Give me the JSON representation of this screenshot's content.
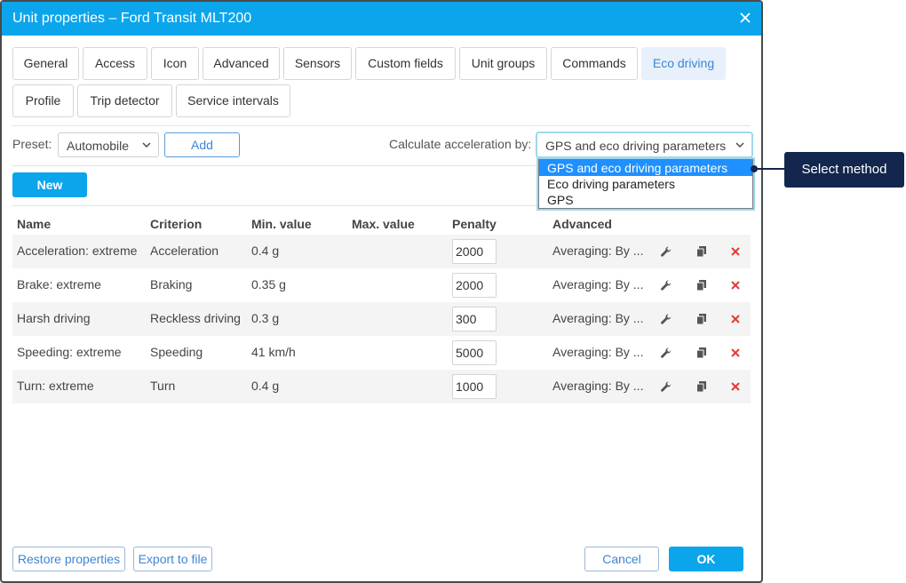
{
  "dialog": {
    "title": "Unit properties – Ford Transit MLT200"
  },
  "tabs": [
    {
      "label": "General"
    },
    {
      "label": "Access"
    },
    {
      "label": "Icon"
    },
    {
      "label": "Advanced"
    },
    {
      "label": "Sensors"
    },
    {
      "label": "Custom fields"
    },
    {
      "label": "Unit groups"
    },
    {
      "label": "Commands"
    },
    {
      "label": "Eco driving",
      "active": true
    },
    {
      "label": "Profile"
    },
    {
      "label": "Trip detector"
    },
    {
      "label": "Service intervals"
    }
  ],
  "toolbar": {
    "preset_label": "Preset:",
    "preset_value": "Automobile",
    "add_label": "Add",
    "accel_label": "Calculate acceleration by:",
    "accel_value": "GPS and eco driving parameters",
    "new_label": "New"
  },
  "dropdown": {
    "options": [
      "GPS and eco driving parameters",
      "Eco driving parameters",
      "GPS"
    ],
    "selected_index": 0
  },
  "callout": {
    "text": "Select method"
  },
  "table": {
    "headers": {
      "name": "Name",
      "criterion": "Criterion",
      "min": "Min. value",
      "max": "Max. value",
      "penalty": "Penalty",
      "advanced": "Advanced"
    },
    "rows": [
      {
        "name": "Acceleration: extreme",
        "criterion": "Acceleration",
        "min": "0.4 g",
        "max": "",
        "penalty": "2000",
        "advanced": "Averaging: By ..."
      },
      {
        "name": "Brake: extreme",
        "criterion": "Braking",
        "min": "0.35 g",
        "max": "",
        "penalty": "2000",
        "advanced": "Averaging: By ..."
      },
      {
        "name": "Harsh driving",
        "criterion": "Reckless driving",
        "min": "0.3 g",
        "max": "",
        "penalty": "300",
        "advanced": "Averaging: By ..."
      },
      {
        "name": "Speeding: extreme",
        "criterion": "Speeding",
        "min": "41 km/h",
        "max": "",
        "penalty": "5000",
        "advanced": "Averaging: By ..."
      },
      {
        "name": "Turn: extreme",
        "criterion": "Turn",
        "min": "0.4 g",
        "max": "",
        "penalty": "1000",
        "advanced": "Averaging: By ..."
      }
    ]
  },
  "footer": {
    "restore_label": "Restore properties",
    "export_label": "Export to file",
    "cancel_label": "Cancel",
    "ok_label": "OK"
  },
  "icons": {
    "close": "close-icon",
    "chevron": "chevron-down-icon",
    "edit": "wrench-icon",
    "copy": "copy-icon",
    "delete": "delete-icon"
  },
  "colors": {
    "accent": "#0ba5ec",
    "active_tab_bg": "#e7f0fb",
    "active_tab_text": "#3d86d6",
    "delete": "#e53935",
    "callout_bg": "#13264d",
    "dropdown_selected": "#1e90ff"
  }
}
